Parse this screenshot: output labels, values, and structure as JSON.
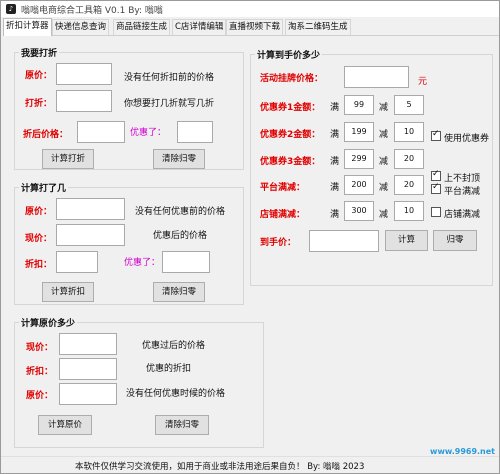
{
  "window": {
    "title": "嗡嗡电商综合工具箱 V0.1    By: 嗡嗡",
    "icon": "app-icon"
  },
  "tabs": [
    {
      "label": "折扣计算器",
      "active": true
    },
    {
      "label": "快递信息查询"
    },
    {
      "label": "商品链接生成"
    },
    {
      "label": "C店详情编辑"
    },
    {
      "label": "直播视频下载"
    },
    {
      "label": "淘系二维码生成"
    }
  ],
  "discount_group": {
    "title": "我要打折",
    "price_label": "原价：",
    "price_hint": "没有任何折扣前的价格",
    "discount_label": "打折：",
    "discount_hint": "你想要打几折就写几折",
    "after_label": "折后价格：",
    "saved_label": "优惠了：",
    "calc_button": "计算打折",
    "clear_button": "清除归零"
  },
  "rate_group": {
    "title": "计算打了几",
    "price_label": "原价：",
    "price_hint": "没有任何优惠前的价格",
    "now_label": "现价：",
    "now_hint": "优惠后的价格",
    "discount_label": "折扣：",
    "saved_label": "优惠了：",
    "calc_button": "计算折扣",
    "clear_button": "清除归零"
  },
  "original_group": {
    "title": "计算原价多少",
    "now_label": "现价：",
    "now_hint": "优惠过后的价格",
    "discount_label": "折扣：",
    "discount_hint": "优惠的折扣",
    "price_label": "原价：",
    "price_hint": "没有任何优惠时候的价格",
    "calc_button": "计算原价",
    "clear_button": "清除归零"
  },
  "final_group": {
    "title": "计算到手价多少",
    "listing_label": "活动挂牌价格：",
    "listing_unit": "元",
    "full_char": "满",
    "minus_char": "减",
    "rows": [
      {
        "label": "优惠券1金额：",
        "threshold": "99",
        "reduce": "5"
      },
      {
        "label": "优惠券2金额：",
        "threshold": "199",
        "reduce": "10"
      },
      {
        "label": "优惠券3金额：",
        "threshold": "299",
        "reduce": "20"
      },
      {
        "label": "平台满减：",
        "threshold": "200",
        "reduce": "20"
      },
      {
        "label": "店铺满减：",
        "threshold": "300",
        "reduce": "10"
      }
    ],
    "use_coupon": {
      "label": "使用优惠券",
      "checked": true
    },
    "no_stack": {
      "label": "上不封顶",
      "checked": true
    },
    "platform_full": {
      "label": "平台满减",
      "checked": true
    },
    "shop_full": {
      "label": "店铺满减",
      "checked": false
    },
    "final_label": "到手价：",
    "calc_button": "计算",
    "clear_button": "归零"
  },
  "status": {
    "text": "本软件仅供学习交流使用，如用于商业或非法用途后果自负！   By: 嗡嗡   2023"
  },
  "watermark": "www.9969.net"
}
